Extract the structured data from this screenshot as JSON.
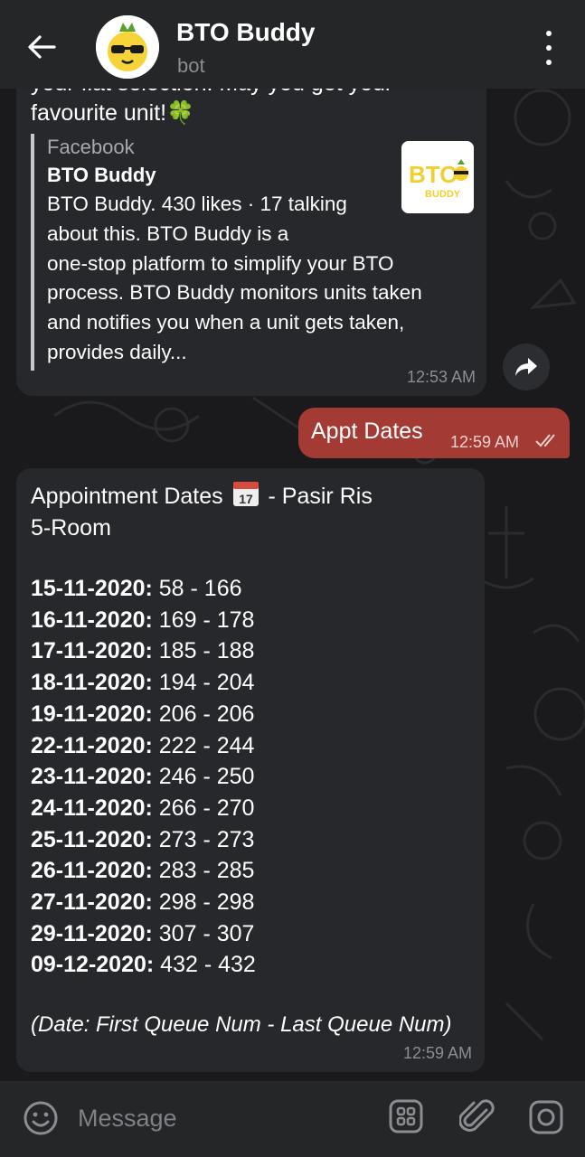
{
  "header": {
    "title": "BTO Buddy",
    "subtitle": "bot",
    "back_icon": "arrow-left-icon",
    "menu_icon": "more-vertical-icon"
  },
  "messages": {
    "link_message": {
      "partial_text": "your flat selection. May you get your",
      "text": "favourite unit!🍀",
      "preview": {
        "site": "Facebook",
        "title": "BTO Buddy",
        "desc_line1": "BTO Buddy. 430 likes · 17 talking",
        "desc_line2": "about this. BTO Buddy is a",
        "desc_line3": "one-stop platform to simplify your BTO",
        "desc_line4": "process. BTO Buddy monitors units taken",
        "desc_line5": "and notifies you when a unit gets taken,",
        "desc_line6": "provides daily..."
      },
      "time": "12:53 AM"
    },
    "sent_message": {
      "text": "Appt Dates",
      "time": "12:59 AM"
    },
    "appointment_message": {
      "heading_part1": "Appointment Dates",
      "heading_part2": "- Pasir Ris",
      "heading_line2": "5-Room",
      "rows": [
        {
          "date": "15-11-2020:",
          "range": "58 - 166"
        },
        {
          "date": "16-11-2020:",
          "range": "169 - 178"
        },
        {
          "date": "17-11-2020:",
          "range": "185 - 188"
        },
        {
          "date": "18-11-2020:",
          "range": "194 - 204"
        },
        {
          "date": "19-11-2020:",
          "range": "206 - 206"
        },
        {
          "date": "22-11-2020:",
          "range": "222 - 244"
        },
        {
          "date": "23-11-2020:",
          "range": "246 - 250"
        },
        {
          "date": "24-11-2020:",
          "range": "266 - 270"
        },
        {
          "date": "25-11-2020:",
          "range": "273 - 273"
        },
        {
          "date": "26-11-2020:",
          "range": "283 - 285"
        },
        {
          "date": "27-11-2020:",
          "range": "298 - 298"
        },
        {
          "date": "29-11-2020:",
          "range": "307 - 307"
        },
        {
          "date": "09-12-2020:",
          "range": "432 - 432"
        }
      ],
      "footnote": "(Date: First Queue Num - Last Queue Num)",
      "time": "12:59 AM"
    }
  },
  "input_bar": {
    "placeholder": "Message"
  },
  "colors": {
    "header_bg": "#252628",
    "bubble_in": "#27282c",
    "bubble_out": "#a43a34",
    "timestamp": "#8b8d92"
  }
}
